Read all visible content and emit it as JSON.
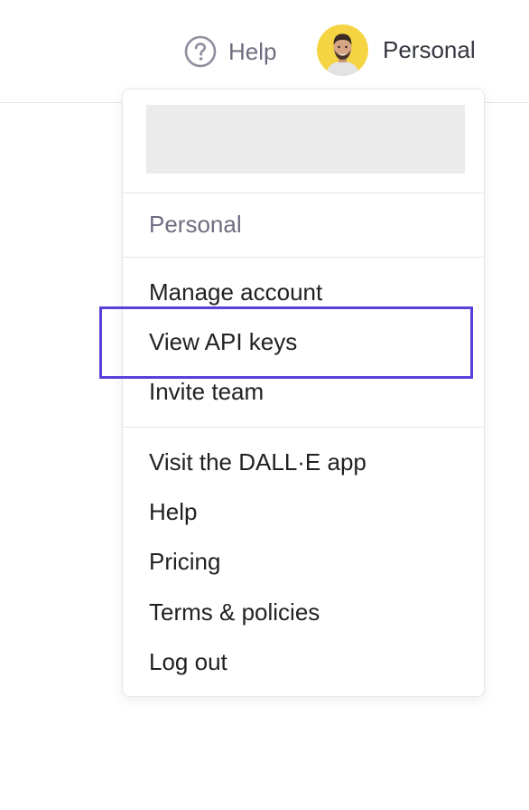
{
  "header": {
    "help_label": "Help",
    "help_icon": "question-circle-icon",
    "account_label": "Personal",
    "avatar_icon": "user-avatar-photo"
  },
  "menu": {
    "org_heading": "Personal",
    "account_items": [
      {
        "label": "Manage account"
      },
      {
        "label": "View API keys",
        "highlighted": true
      },
      {
        "label": "Invite team"
      }
    ],
    "general_items": [
      {
        "label": "Visit the DALL·E app"
      },
      {
        "label": "Help"
      },
      {
        "label": "Pricing"
      },
      {
        "label": "Terms & policies"
      },
      {
        "label": "Log out"
      }
    ]
  },
  "colors": {
    "highlight": "#5b3fdb",
    "avatar_bg": "#f5d443",
    "muted_text": "#6e6e80",
    "placeholder": "#ebebeb"
  }
}
